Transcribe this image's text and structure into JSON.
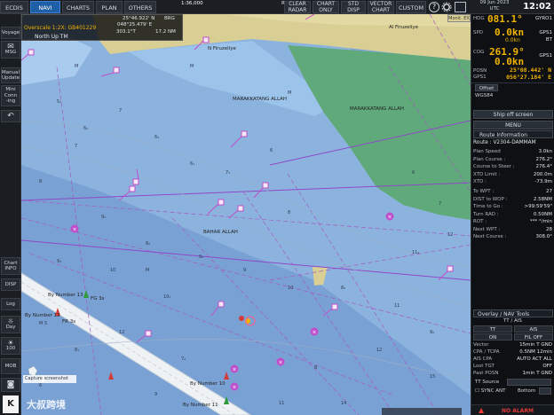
{
  "topbar": {
    "ecdis": "ECDIS",
    "navi": "NAVI",
    "charts": "CHARTS",
    "plan": "PLAN",
    "others": "OTHERS",
    "scale": "1:36,000",
    "cursor_lat": "25°46.922' N",
    "cursor_lon": "048°25.479' E",
    "rng_label": "RNG",
    "brg_label": "BRG",
    "rng_val": "303.1°T",
    "brg_val": "17.2 NM",
    "clear_radar": [
      "CLEAR",
      "RADAR"
    ],
    "chart_only": [
      "CHART",
      "ONLY"
    ],
    "std_disp": [
      "STD",
      "DISP"
    ],
    "vector_chart": [
      "VECTOR",
      "CHART"
    ],
    "custom": "CUSTOM",
    "help_icon": "?",
    "date": "09 Jun 2023",
    "utc": "UTC",
    "time": "12:02"
  },
  "left": {
    "voyage": "Voyage",
    "msg": "MSG",
    "manual_update": [
      "Manual",
      "Update"
    ],
    "mini_conning": [
      "Mini",
      "Conn",
      "-ing"
    ],
    "chart_info": [
      "Chart",
      "INFO"
    ],
    "disp": "DISP",
    "log": "Log",
    "day": "Day",
    "brightness": "100",
    "mob": "MOB"
  },
  "infobox": {
    "overscale": "Overscale 1:2X: GB401229",
    "mode": "North Up TM"
  },
  "chart": {
    "labels": {
      "al_firuzeliye": "Al Firuzeliye",
      "n_firuzeliye": "N Firuzeliye",
      "marakkatang_allah_1": "MARAKKATANG ALLAH",
      "marakkatang_allah_2": "MARAKKATANG ALLAH",
      "bahar_allah": "BAHAR ALLAH",
      "by_number_13": "By Number 13",
      "by_number_12": "By Number 12",
      "by_number_10": "By Number 10",
      "by_number_11": "By Number 11",
      "fr_3s": "FR 3s",
      "fg_3s": "FG 3s",
      "monit_ex": "Monit. EX",
      "capture_screenshot": "Capture screenshot",
      "watermark": "大叔跨境"
    },
    "colors": {
      "deep": "#7fa6d8",
      "shallow": "#9dc2e6",
      "land": "#d9cf95",
      "green": "#5fa97a",
      "route": "#c04ecb"
    }
  },
  "right": {
    "hdg_label": "HDG",
    "hdg_val": "081.1°",
    "hdg_src": "GYRO1",
    "spd_label": "SPD",
    "spd_val": "0.0kn",
    "spd_sub": "0.0kn",
    "spd_src1": "GPS1",
    "spd_src2": "BT",
    "cog_label": "COG",
    "cog_val": "261.9°",
    "sog_val": "0.0kn",
    "cog_src": "GPS1",
    "posn_label": "POSN",
    "posn_src": "GPS1",
    "lat": "25°08.442' N",
    "lon": "056°27.184' E",
    "offset": "Offset",
    "datum": "WGS84",
    "ship_off_screen": "Ship off screen",
    "menu": "MENU",
    "route_info": "Route Information",
    "route": "Route : V2304-DAMMAM",
    "rows": [
      {
        "k": "Plan Speed",
        "v": "3.0kn"
      },
      {
        "k": "Plan Course :",
        "v": "276.2°"
      },
      {
        "k": "Course to Steer :",
        "v": "276.4°"
      },
      {
        "k": "XTD Limit :",
        "v": "200.0m"
      },
      {
        "k": "XTD :",
        "v": "-73.9m"
      }
    ],
    "rows2": [
      {
        "k": "To WPT :",
        "v": "27"
      },
      {
        "k": "DIST to WOP :",
        "v": "2.58NM"
      },
      {
        "k": "Time to Go :",
        "v": ">99:59'59\""
      },
      {
        "k": "Turn RAD :",
        "v": "0.50NM"
      },
      {
        "k": "ROT :",
        "v": "*** °/min"
      },
      {
        "k": "Next WPT :",
        "v": "28"
      },
      {
        "k": "Next Course :",
        "v": "308.0°"
      }
    ],
    "overlay_title": "Overlay / NAV Tools",
    "tt_ais": "TT / AIS",
    "tt": "TT",
    "ais": "AIS",
    "on": "ON",
    "fil_off": "FIL OFF",
    "ovr_rows": [
      {
        "k": "Vector",
        "v": "15min  T  GND"
      },
      {
        "k": "CPA / TCPA",
        "v": "0.5NM  12min"
      },
      {
        "k": "AIS CPA",
        "v": "AUTO ACT  ALL"
      },
      {
        "k": "Lost TGT",
        "v": "OFF"
      },
      {
        "k": "Past POSN",
        "v": "1min  T  GND"
      }
    ],
    "tt_source": "TT Source",
    "sync_ant": "SYNC ANT",
    "bottom": "Bottom",
    "alarm": "NO ALARM"
  }
}
